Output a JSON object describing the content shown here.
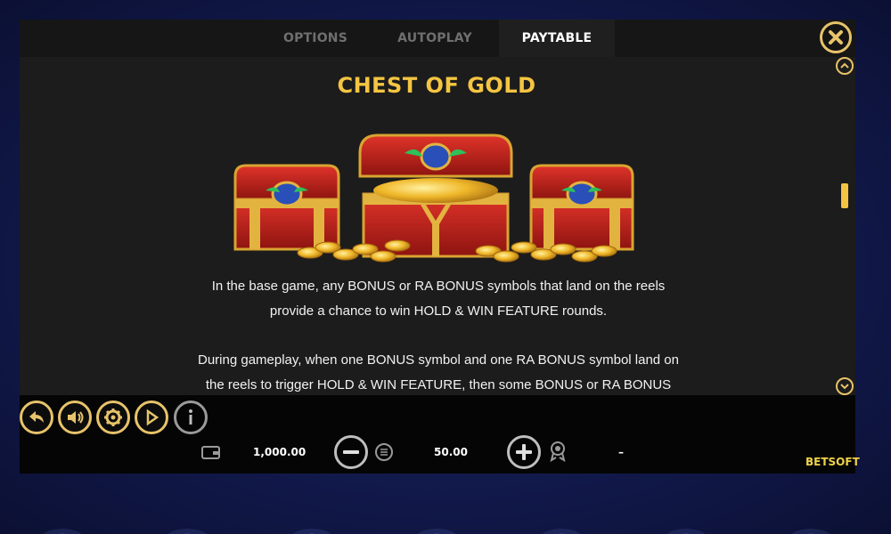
{
  "tabs": [
    {
      "label": "OPTIONS",
      "active": false
    },
    {
      "label": "AUTOPLAY",
      "active": false
    },
    {
      "label": "PAYTABLE",
      "active": true
    }
  ],
  "content": {
    "title": "CHEST OF GOLD",
    "paragraph1": "In the base game, any BONUS or RA BONUS symbols that land on the reels provide a chance to win HOLD & WIN FEATURE rounds.",
    "paragraph2": "During gameplay, when one BONUS symbol and one RA BONUS symbol land on the reels to trigger HOLD & WIN FEATURE, then some BONUS or RA BONUS"
  },
  "controls": {
    "icons": [
      "back-arrow-icon",
      "sound-icon",
      "settings-gear-icon",
      "autoplay-icon",
      "info-icon"
    ]
  },
  "bet_bar": {
    "balance": "1,000.00",
    "bet": "50.00",
    "win": "–"
  },
  "brand": "BETSOFT",
  "colors": {
    "accent_gold": "#f4c542",
    "panel_bg": "#1c1c1c",
    "bar_bg": "#050505",
    "page_bg": "#121a4d"
  }
}
